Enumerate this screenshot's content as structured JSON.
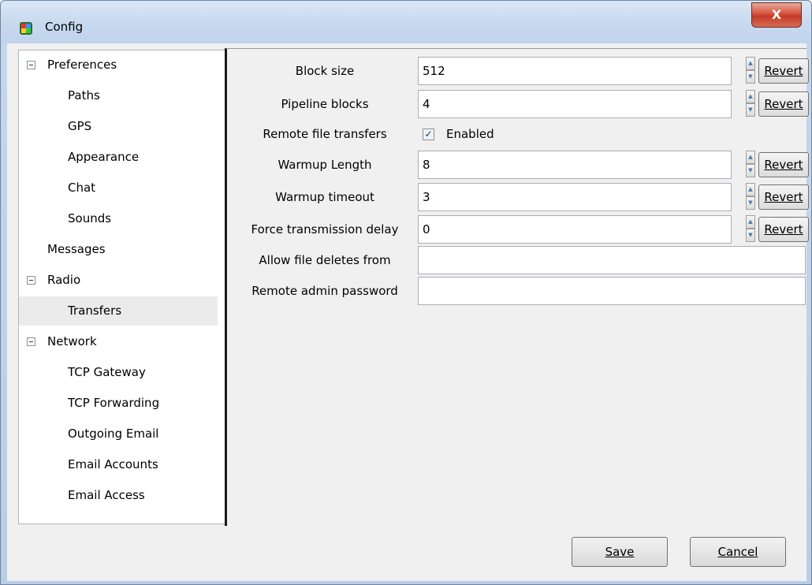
{
  "window": {
    "title": "Config",
    "close_label": "X"
  },
  "tree": {
    "items": [
      {
        "label": "Preferences",
        "level": 0,
        "expandable": true
      },
      {
        "label": "Paths",
        "level": 1
      },
      {
        "label": "GPS",
        "level": 1
      },
      {
        "label": "Appearance",
        "level": 1
      },
      {
        "label": "Chat",
        "level": 1
      },
      {
        "label": "Sounds",
        "level": 1
      },
      {
        "label": "Messages",
        "level": 0
      },
      {
        "label": "Radio",
        "level": 0,
        "expandable": true
      },
      {
        "label": "Transfers",
        "level": 1,
        "selected": true
      },
      {
        "label": "Network",
        "level": 0,
        "expandable": true
      },
      {
        "label": "TCP Gateway",
        "level": 1
      },
      {
        "label": "TCP Forwarding",
        "level": 1
      },
      {
        "label": "Outgoing Email",
        "level": 1
      },
      {
        "label": "Email Accounts",
        "level": 1
      },
      {
        "label": "Email Access",
        "level": 1
      }
    ]
  },
  "settings": {
    "block_size": {
      "label": "Block size",
      "value": "512"
    },
    "pipeline_blocks": {
      "label": "Pipeline blocks",
      "value": "4"
    },
    "remote_file_transfers": {
      "label": "Remote file transfers",
      "checkbox_label": "Enabled",
      "checked": true
    },
    "warmup_length": {
      "label": "Warmup Length",
      "value": "8"
    },
    "warmup_timeout": {
      "label": "Warmup timeout",
      "value": "3"
    },
    "force_transmission_delay": {
      "label": "Force transmission delay",
      "value": "0"
    },
    "allow_file_deletes": {
      "label": "Allow file deletes from",
      "value": ""
    },
    "remote_admin_password": {
      "label": "Remote admin password",
      "value": ""
    },
    "revert_label": "Revert"
  },
  "footer": {
    "save_label": "Save",
    "cancel_label": "Cancel"
  }
}
